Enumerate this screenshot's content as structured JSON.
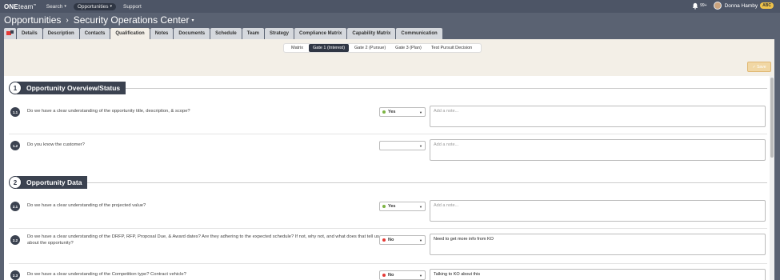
{
  "topbar": {
    "logo_one": "ONE",
    "logo_team": "team",
    "logo_mark": "™",
    "nav": [
      {
        "label": "Search",
        "active": false
      },
      {
        "label": "Opportunities",
        "active": true
      },
      {
        "label": "Support",
        "active": false
      }
    ],
    "notifications_label": "99+",
    "user_name": "Donna Hamby",
    "user_badge": "ABC"
  },
  "header": {
    "breadcrumb_root": "Opportunities",
    "breadcrumb_sep": "›",
    "page_title": "Security Operations Center"
  },
  "tabs": [
    "Details",
    "Description",
    "Contacts",
    "Qualification",
    "Notes",
    "Documents",
    "Schedule",
    "Team",
    "Strategy",
    "Compliance Matrix",
    "Capability Matrix",
    "Communication"
  ],
  "active_tab": "Qualification",
  "gates": [
    "Matrix",
    "Gate 1 (Interest)",
    "Gate 2 (Pursue)",
    "Gate 3 (Plan)",
    "Test Pursuit Decision"
  ],
  "active_gate": "Gate 1 (Interest)",
  "save_label": "✓ Save",
  "colors": {
    "yes": "#7cb342",
    "no": "#e53935",
    "dark": "#3b4250"
  },
  "sections": [
    {
      "number": "1",
      "title": "Opportunity Overview/Status",
      "questions": [
        {
          "number": "1.1",
          "text": "Do we have a clear understanding of the opportunity title, description, & scope?",
          "answer": "Yes",
          "note": "",
          "note_placeholder": "Add a note..."
        },
        {
          "number": "1.2",
          "text": "Do you know the customer?",
          "answer": "",
          "note": "",
          "note_placeholder": "Add a note..."
        }
      ]
    },
    {
      "number": "2",
      "title": "Opportunity Data",
      "questions": [
        {
          "number": "2.1",
          "text": "Do we have a clear understanding of the projected value?",
          "answer": "Yes",
          "note": "",
          "note_placeholder": "Add a note..."
        },
        {
          "number": "2.2",
          "text": "Do we have a clear understanding of the DRFP, RFP, Proposal Due, & Award dates? Are they adhering to the expected schedule? If not, why not, and what does that tell us about the opportunity?",
          "answer": "No",
          "note": "Need to get more info from KO",
          "note_placeholder": "Add a note..."
        },
        {
          "number": "2.3",
          "text": "Do we have a clear understanding of the Competition type? Contract vehicle?",
          "answer": "No",
          "note": "Talking to KO about this",
          "note_placeholder": "Add a note..."
        }
      ]
    }
  ]
}
